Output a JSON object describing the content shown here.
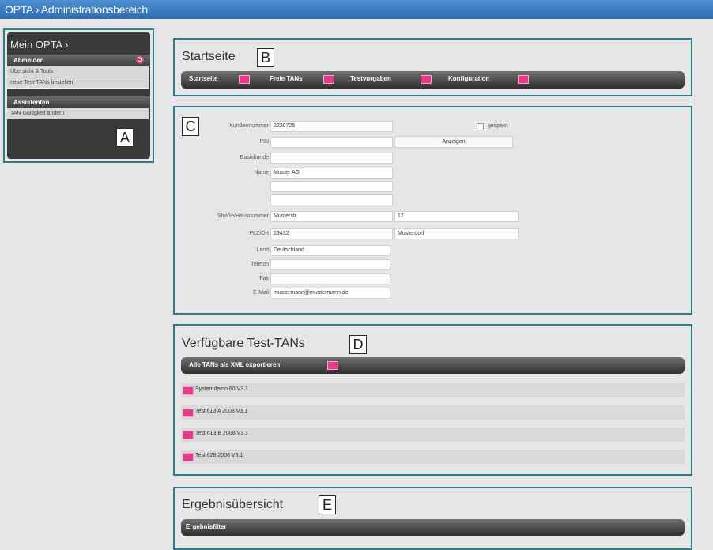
{
  "window": {
    "title": "OPTA › Administrationsbereich"
  },
  "sidebar": {
    "title": "Mein OPTA ›",
    "logout_label": "Abmelden",
    "logout_icon": "logout-icon",
    "menu_items": [
      "Übersicht & Tools",
      "neue Test-TANs bestellen"
    ],
    "assistants_label": "Assistenten",
    "assistant_items": [
      "TAN Gültigkeit ändern"
    ]
  },
  "callouts": {
    "a": "A",
    "b": "B",
    "c": "C",
    "d": "D",
    "e": "E"
  },
  "start": {
    "title": "Startseite",
    "nav": [
      "Startseite",
      "Freie TANs",
      "Testvorgaben",
      "Konfiguration"
    ]
  },
  "form": {
    "labels": {
      "customer_number": "Kundennummer",
      "pin": "PIN",
      "master_customer": "Basiskunde",
      "name": "Name",
      "street": "Straße/Hausnummer",
      "zip_city": "PLZ/Ort",
      "country": "Land",
      "phone": "Telefon",
      "fax": "Fax",
      "email": "E-Mail",
      "locked": "gesperrt"
    },
    "values": {
      "customer_number": "2220725",
      "name": "Muster AG",
      "street": "Musterstr.",
      "house_number": "12",
      "zip": "23432",
      "city": "Musterdorf",
      "country": "Deutschland",
      "email": "mustermann@mustermann.de"
    },
    "show_button": "Anzeigen"
  },
  "tans": {
    "title": "Verfügbare Test-TANs",
    "export_label": "Alle TANs als XML exportieren",
    "items": [
      "Systemdemo 60 V3.1",
      "Test 613 A 2008 V3.1",
      "Test 613 B 2008 V3.1",
      "Test 628 2008 V3.1"
    ]
  },
  "results": {
    "title": "Ergebnisübersicht",
    "filter_label": "Ergebnisfilter"
  }
}
